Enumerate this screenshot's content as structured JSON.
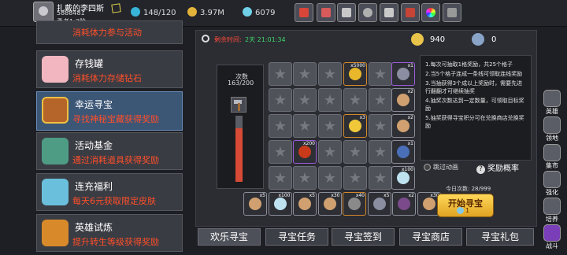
{
  "player": {
    "name": "扎戴的李四斯",
    "id": "5888481",
    "rank": "勇者1-2阶"
  },
  "resources": {
    "stamina": "148/120",
    "gold": "3.97M",
    "diamonds": "6079"
  },
  "sidebar": {
    "items": [
      {
        "title": "",
        "desc": "消耗体力参与活动"
      },
      {
        "title": "存钱罐",
        "desc": "消耗体力存储钻石"
      },
      {
        "title": "幸运寻宝",
        "desc": "寻找神秘宝藏获得奖励"
      },
      {
        "title": "活动基金",
        "desc": "通过消耗道具获得奖励"
      },
      {
        "title": "连充福利",
        "desc": "每天6元获取限定皮肤"
      },
      {
        "title": "英雄试炼",
        "desc": "提升转生等级获得奖励"
      }
    ]
  },
  "timer": {
    "label": "剩余时间:",
    "value": "2天 21:01:34"
  },
  "balances": {
    "coins": "940",
    "keys": "0"
  },
  "chest": {
    "label": "次数",
    "count": "163/200",
    "progress": 0.815
  },
  "grid": {
    "rows": [
      [
        "",
        "",
        "",
        "x5000",
        "",
        "x1"
      ],
      [
        "",
        "",
        "",
        "",
        "",
        "x2"
      ],
      [
        "",
        "",
        "",
        "x3",
        "",
        "x2"
      ],
      [
        "",
        "x200",
        "",
        "",
        "",
        "x1"
      ],
      [
        "",
        "",
        "",
        "",
        "",
        "x100"
      ]
    ],
    "bottom": [
      "x5",
      "x100",
      "x5",
      "x30",
      "x40",
      "x5",
      "x2",
      "x30"
    ]
  },
  "rules": [
    "1.每次可抽取1格奖励，共25个格子",
    "2.当5个格子连成一条线可领取连线奖励",
    "3.当抽获得3个成以上奖励时，需要先进行翻翻才可继续抽奖",
    "4.抽奖次数达到一定数量，可领取目标奖励",
    "5.抽奖获得寻宝积分可在兑换商店兑换奖励"
  ],
  "skip_label": "跳过动画",
  "prob_label": "奖励概率",
  "today": "今日次数: 28/999",
  "start": {
    "label": "开始寻宝",
    "cost": "1"
  },
  "tabs": [
    "欢乐寻宝",
    "寻宝任务",
    "寻宝签到",
    "寻宝商店",
    "寻宝礼包"
  ],
  "right_menu": [
    "英雄",
    "领地",
    "集市",
    "强化",
    "培养",
    "战斗"
  ],
  "colors": {
    "accent_red": "#ff4f2a",
    "active_blue": "#3c5676",
    "gold": "#e0a322"
  }
}
